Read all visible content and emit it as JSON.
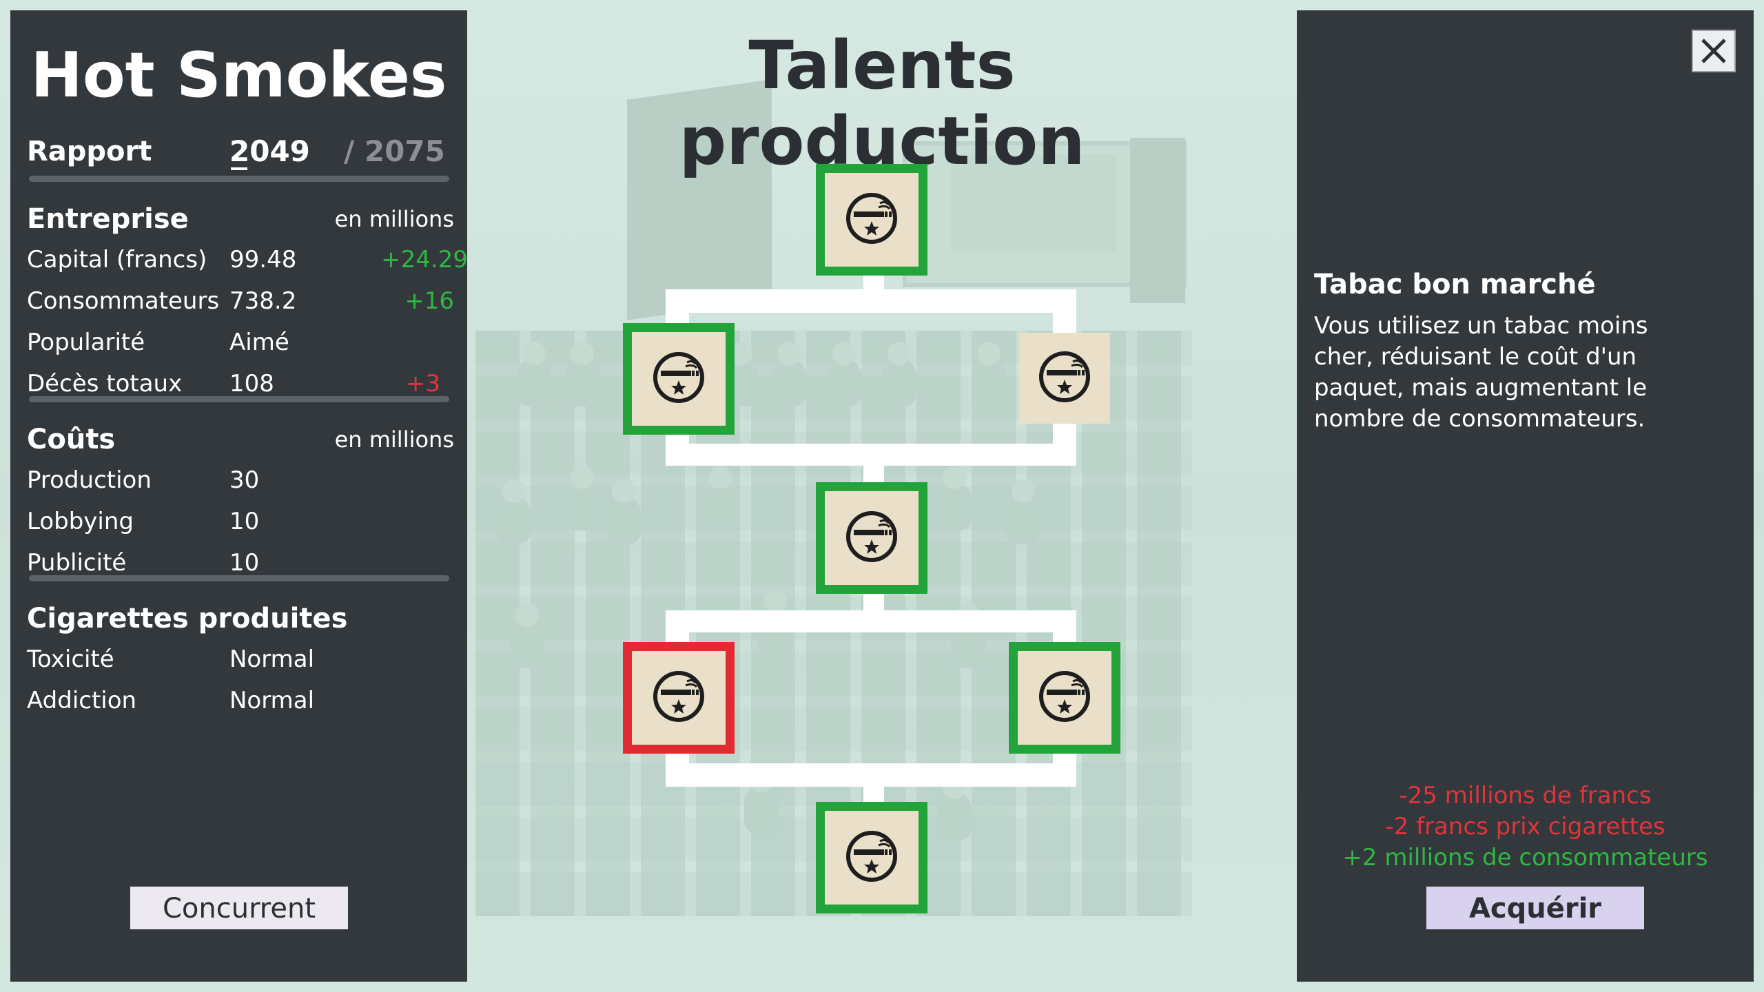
{
  "left_panel": {
    "title": "Hot Smokes",
    "report": {
      "label": "Rapport",
      "year": "2049",
      "max_year": "/ 2075"
    },
    "company": {
      "heading": "Entreprise",
      "unit": "en millions",
      "rows": [
        {
          "label": "Capital (francs)",
          "value": "99.48",
          "delta": "+24.29",
          "delta_type": "positive"
        },
        {
          "label": "Consommateurs",
          "value": "738.2",
          "delta": "+16",
          "delta_type": "positive"
        },
        {
          "label": "Popularité",
          "value": "Aimé",
          "delta": "",
          "delta_type": ""
        },
        {
          "label": "Décès totaux",
          "value": "108",
          "delta": "+3",
          "delta_type": "negative"
        }
      ]
    },
    "costs": {
      "heading": "Coûts",
      "unit": "en millions",
      "rows": [
        {
          "label": "Production",
          "value": "30"
        },
        {
          "label": "Lobbying",
          "value": "10"
        },
        {
          "label": "Publicité",
          "value": "10"
        }
      ]
    },
    "cigarettes": {
      "heading": "Cigarettes produites",
      "rows": [
        {
          "label": "Toxicité",
          "value": "Normal"
        },
        {
          "label": "Addiction",
          "value": "Normal"
        }
      ]
    },
    "competitor_button": "Concurrent"
  },
  "tree": {
    "title": "Talents production",
    "icon": "cigarette-star-icon",
    "nodes": [
      {
        "id": "n1",
        "state": "owned"
      },
      {
        "id": "n2-left",
        "state": "owned"
      },
      {
        "id": "n2-right",
        "state": "available"
      },
      {
        "id": "n3",
        "state": "owned"
      },
      {
        "id": "n4-left",
        "state": "blocked"
      },
      {
        "id": "n4-right",
        "state": "owned"
      },
      {
        "id": "n5",
        "state": "owned"
      }
    ],
    "colors": {
      "owned": "#23a43a",
      "blocked": "#e12a32",
      "tile": "#eadfc8"
    }
  },
  "right_panel": {
    "close_icon": "close-icon",
    "talent_name": "Tabac bon marché",
    "talent_description": "Vous utilisez un tabac moins cher, réduisant le coût d'un paquet, mais augmentant le nombre de consommateurs.",
    "effects": [
      {
        "text": "-25 millions de francs",
        "type": "negative"
      },
      {
        "text": "-2 francs prix cigarettes",
        "type": "negative"
      },
      {
        "text": "+2 millions de consommateurs",
        "type": "positive"
      }
    ],
    "acquire_button": "Acquérir"
  }
}
